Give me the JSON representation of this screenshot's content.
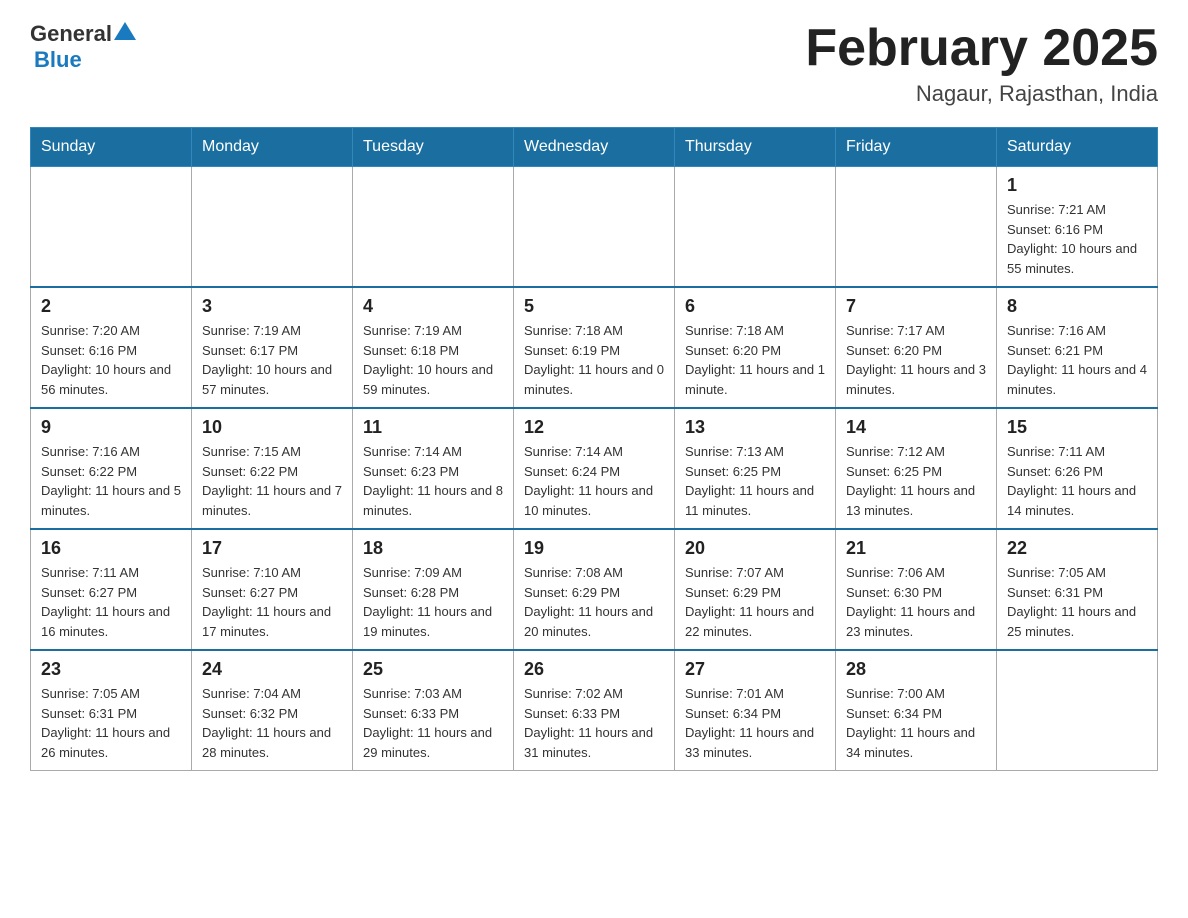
{
  "header": {
    "logo": {
      "general": "General",
      "blue": "Blue",
      "triangle": "▲"
    },
    "title": "February 2025",
    "location": "Nagaur, Rajasthan, India"
  },
  "calendar": {
    "days_of_week": [
      "Sunday",
      "Monday",
      "Tuesday",
      "Wednesday",
      "Thursday",
      "Friday",
      "Saturday"
    ],
    "weeks": [
      [
        {
          "day": "",
          "info": ""
        },
        {
          "day": "",
          "info": ""
        },
        {
          "day": "",
          "info": ""
        },
        {
          "day": "",
          "info": ""
        },
        {
          "day": "",
          "info": ""
        },
        {
          "day": "",
          "info": ""
        },
        {
          "day": "1",
          "info": "Sunrise: 7:21 AM\nSunset: 6:16 PM\nDaylight: 10 hours and 55 minutes."
        }
      ],
      [
        {
          "day": "2",
          "info": "Sunrise: 7:20 AM\nSunset: 6:16 PM\nDaylight: 10 hours and 56 minutes."
        },
        {
          "day": "3",
          "info": "Sunrise: 7:19 AM\nSunset: 6:17 PM\nDaylight: 10 hours and 57 minutes."
        },
        {
          "day": "4",
          "info": "Sunrise: 7:19 AM\nSunset: 6:18 PM\nDaylight: 10 hours and 59 minutes."
        },
        {
          "day": "5",
          "info": "Sunrise: 7:18 AM\nSunset: 6:19 PM\nDaylight: 11 hours and 0 minutes."
        },
        {
          "day": "6",
          "info": "Sunrise: 7:18 AM\nSunset: 6:20 PM\nDaylight: 11 hours and 1 minute."
        },
        {
          "day": "7",
          "info": "Sunrise: 7:17 AM\nSunset: 6:20 PM\nDaylight: 11 hours and 3 minutes."
        },
        {
          "day": "8",
          "info": "Sunrise: 7:16 AM\nSunset: 6:21 PM\nDaylight: 11 hours and 4 minutes."
        }
      ],
      [
        {
          "day": "9",
          "info": "Sunrise: 7:16 AM\nSunset: 6:22 PM\nDaylight: 11 hours and 5 minutes."
        },
        {
          "day": "10",
          "info": "Sunrise: 7:15 AM\nSunset: 6:22 PM\nDaylight: 11 hours and 7 minutes."
        },
        {
          "day": "11",
          "info": "Sunrise: 7:14 AM\nSunset: 6:23 PM\nDaylight: 11 hours and 8 minutes."
        },
        {
          "day": "12",
          "info": "Sunrise: 7:14 AM\nSunset: 6:24 PM\nDaylight: 11 hours and 10 minutes."
        },
        {
          "day": "13",
          "info": "Sunrise: 7:13 AM\nSunset: 6:25 PM\nDaylight: 11 hours and 11 minutes."
        },
        {
          "day": "14",
          "info": "Sunrise: 7:12 AM\nSunset: 6:25 PM\nDaylight: 11 hours and 13 minutes."
        },
        {
          "day": "15",
          "info": "Sunrise: 7:11 AM\nSunset: 6:26 PM\nDaylight: 11 hours and 14 minutes."
        }
      ],
      [
        {
          "day": "16",
          "info": "Sunrise: 7:11 AM\nSunset: 6:27 PM\nDaylight: 11 hours and 16 minutes."
        },
        {
          "day": "17",
          "info": "Sunrise: 7:10 AM\nSunset: 6:27 PM\nDaylight: 11 hours and 17 minutes."
        },
        {
          "day": "18",
          "info": "Sunrise: 7:09 AM\nSunset: 6:28 PM\nDaylight: 11 hours and 19 minutes."
        },
        {
          "day": "19",
          "info": "Sunrise: 7:08 AM\nSunset: 6:29 PM\nDaylight: 11 hours and 20 minutes."
        },
        {
          "day": "20",
          "info": "Sunrise: 7:07 AM\nSunset: 6:29 PM\nDaylight: 11 hours and 22 minutes."
        },
        {
          "day": "21",
          "info": "Sunrise: 7:06 AM\nSunset: 6:30 PM\nDaylight: 11 hours and 23 minutes."
        },
        {
          "day": "22",
          "info": "Sunrise: 7:05 AM\nSunset: 6:31 PM\nDaylight: 11 hours and 25 minutes."
        }
      ],
      [
        {
          "day": "23",
          "info": "Sunrise: 7:05 AM\nSunset: 6:31 PM\nDaylight: 11 hours and 26 minutes."
        },
        {
          "day": "24",
          "info": "Sunrise: 7:04 AM\nSunset: 6:32 PM\nDaylight: 11 hours and 28 minutes."
        },
        {
          "day": "25",
          "info": "Sunrise: 7:03 AM\nSunset: 6:33 PM\nDaylight: 11 hours and 29 minutes."
        },
        {
          "day": "26",
          "info": "Sunrise: 7:02 AM\nSunset: 6:33 PM\nDaylight: 11 hours and 31 minutes."
        },
        {
          "day": "27",
          "info": "Sunrise: 7:01 AM\nSunset: 6:34 PM\nDaylight: 11 hours and 33 minutes."
        },
        {
          "day": "28",
          "info": "Sunrise: 7:00 AM\nSunset: 6:34 PM\nDaylight: 11 hours and 34 minutes."
        },
        {
          "day": "",
          "info": ""
        }
      ]
    ]
  }
}
